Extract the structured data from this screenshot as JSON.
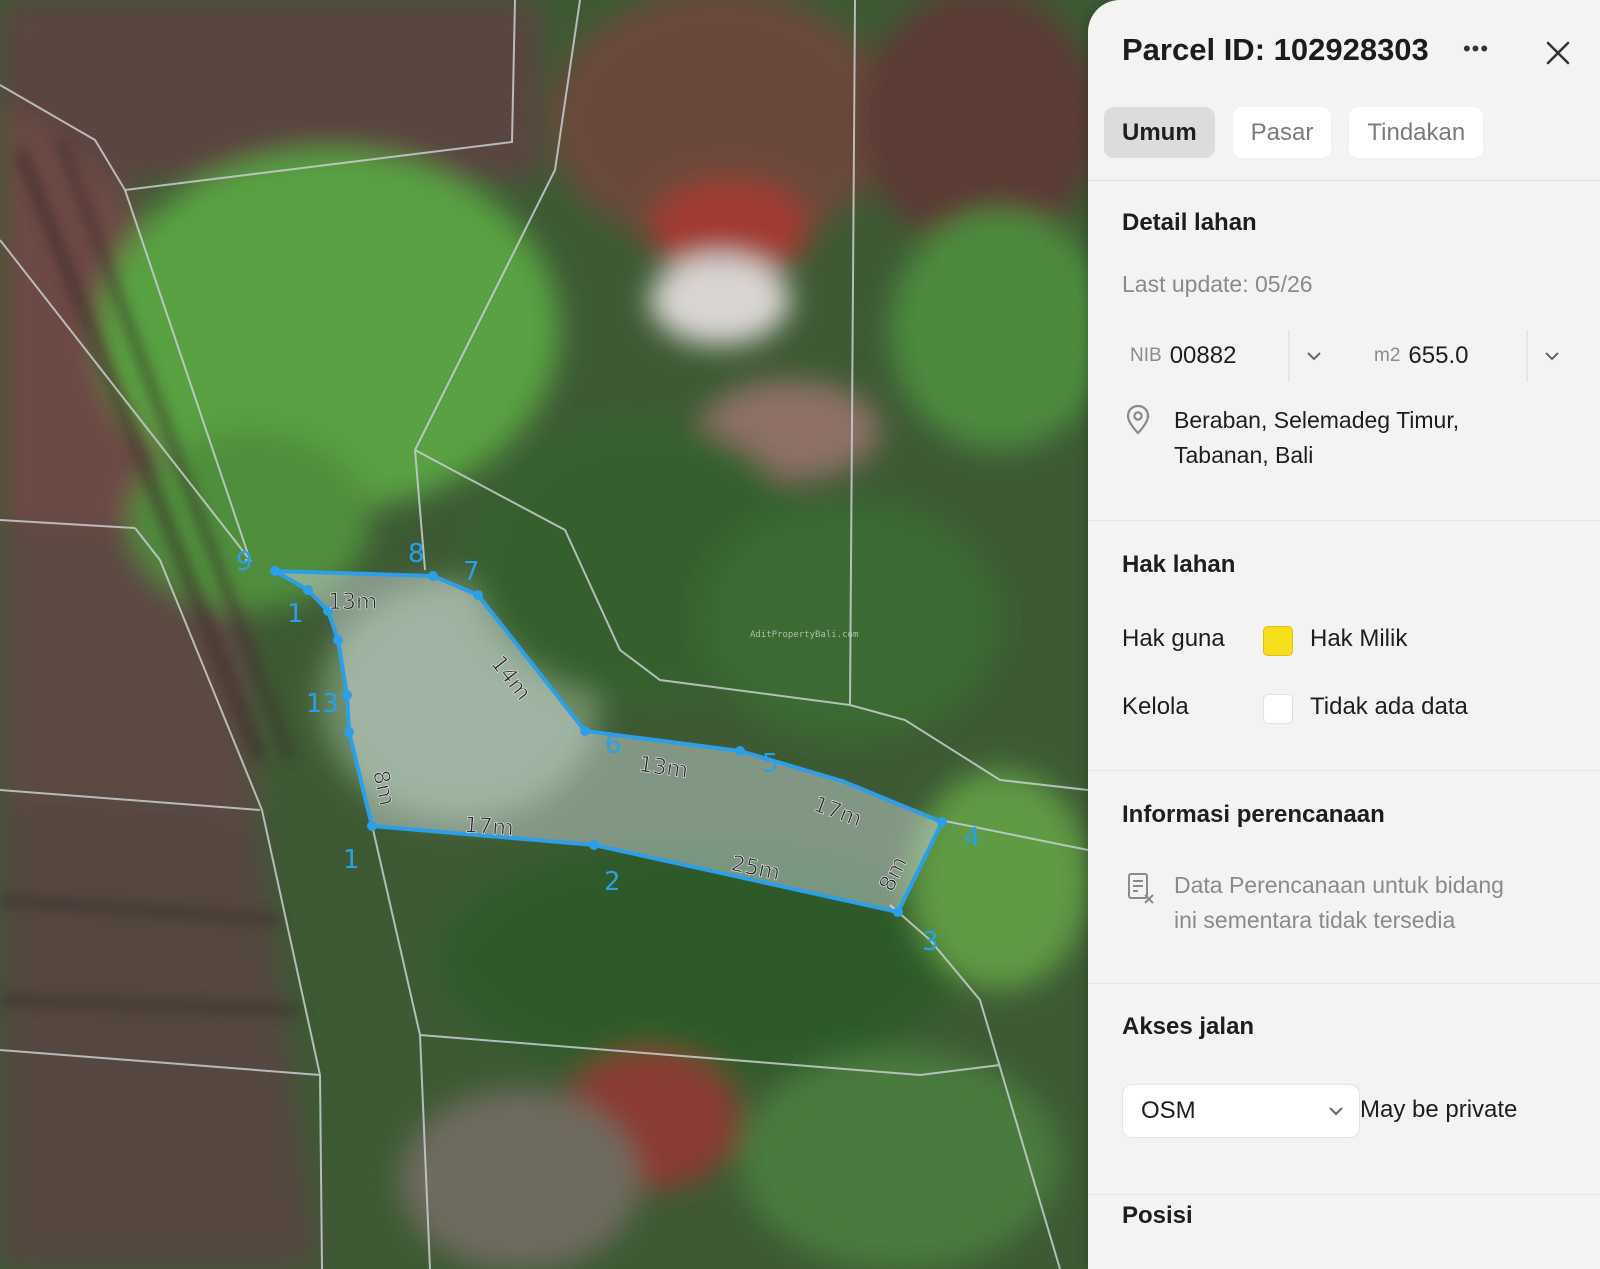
{
  "map": {
    "watermark": "AditPropertyBali.com",
    "vertex_labels": [
      "1",
      "2",
      "3",
      "4",
      "5",
      "6",
      "7",
      "8",
      "9",
      "1",
      "13"
    ],
    "edge_labels": [
      "13m",
      "14m",
      "13m",
      "17m",
      "8m",
      "25m",
      "17m",
      "8m"
    ],
    "accent_color": "#2d9ee8"
  },
  "panel": {
    "title": "Parcel ID: 102928303",
    "more_icon": "ellipsis-icon",
    "close_icon": "close-icon",
    "tabs": [
      "Umum",
      "Pasar",
      "Tindakan"
    ],
    "active_tab": "Umum",
    "detail": {
      "heading": "Detail lahan",
      "last_update": "Last update: 05/26",
      "nib_label": "NIB",
      "nib_value": "00882",
      "area_label": "m2",
      "area_value": "655.0",
      "location_line1": "Beraban, Selemadeg Timur,",
      "location_line2": "Tabanan, Bali"
    },
    "rights": {
      "heading": "Hak lahan",
      "rows": [
        {
          "label": "Hak guna",
          "value": "Hak Milik",
          "color": "#f5de1a"
        },
        {
          "label": "Kelola",
          "value": "Tidak ada data",
          "color": "#ffffff"
        }
      ]
    },
    "planning": {
      "heading": "Informasi perencanaan",
      "message_line1": "Data Perencanaan untuk bidang",
      "message_line2": "ini sementara tidak tersedia"
    },
    "access": {
      "heading": "Akses jalan",
      "select_value": "OSM",
      "note": "May be private"
    },
    "position": {
      "heading": "Posisi"
    }
  }
}
